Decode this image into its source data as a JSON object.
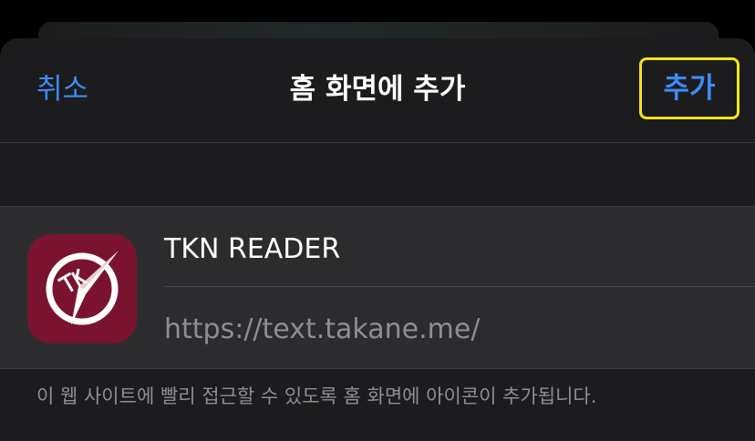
{
  "navbar": {
    "cancel_label": "취소",
    "title": "홈 화면에 추가",
    "add_label": "추가"
  },
  "app": {
    "name": "TKN READER",
    "url": "https://text.takane.me/",
    "icon_name": "compass-logo-icon",
    "icon_color": "#7a1330"
  },
  "footnote": "이 웹 사이트에 빨리 접근할 수 있도록 홈 화면에 아이콘이 추가됩니다.",
  "colors": {
    "accent": "#3e8bf7",
    "highlight": "#f2e31c"
  }
}
